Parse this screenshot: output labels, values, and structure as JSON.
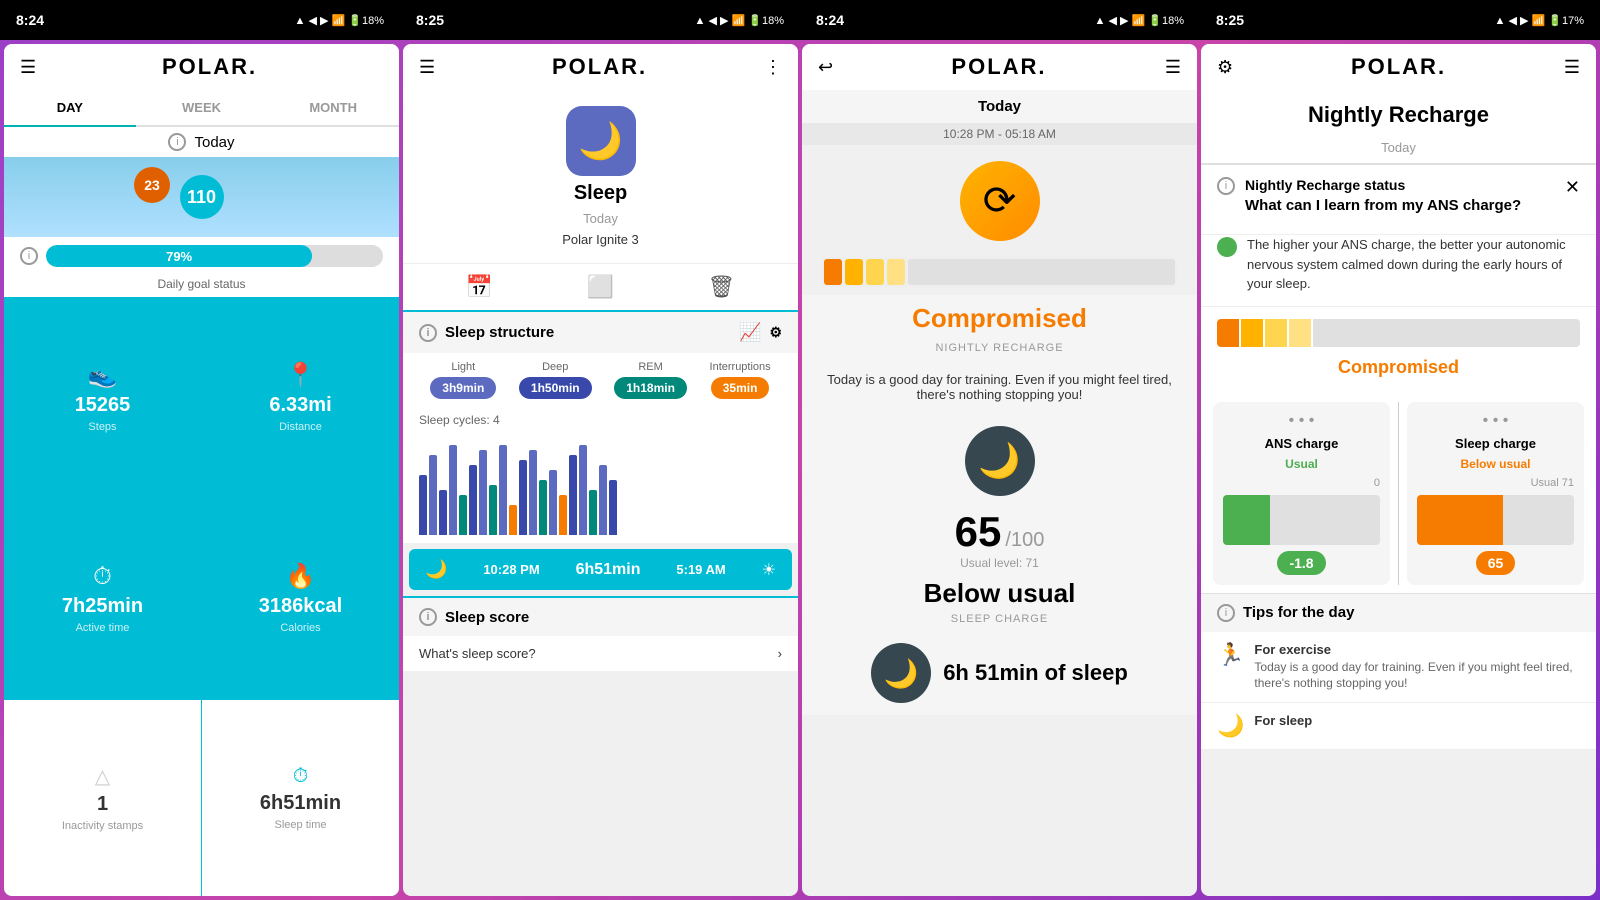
{
  "statusBars": [
    {
      "time": "8:24",
      "icons": "▲ ▼📶🔋18%"
    },
    {
      "time": "8:25",
      "icons": "▲ ▼📶🔋18%"
    },
    {
      "time": "8:24",
      "icons": "▲ ▼📶🔋18%"
    },
    {
      "time": "8:25",
      "icons": "▲ ▼📶🔋17%"
    }
  ],
  "screen1": {
    "tabs": [
      "DAY",
      "WEEK",
      "MONTH"
    ],
    "activeTab": "DAY",
    "todayLabel": "Today",
    "scoreOrange": "23",
    "scoreBadge": "110",
    "progressPct": "79%",
    "progressLabel": "Daily goal status",
    "stats": [
      {
        "icon": "👟",
        "value": "15265",
        "label": "Steps"
      },
      {
        "icon": "📍",
        "value": "6.33mi",
        "label": "Distance"
      },
      {
        "icon": "⏱",
        "value": "7h25min",
        "label": "Active time"
      },
      {
        "icon": "🔥",
        "value": "3186kcal",
        "label": "Calories"
      }
    ],
    "inactivityIcon": "△",
    "inactivityValue": "1",
    "inactivityLabel": "Inactivity stamps",
    "sleepIcon": "⏱",
    "sleepValue": "6h51min",
    "sleepLabel": "Sleep time"
  },
  "screen2": {
    "sleepTitle": "Sleep",
    "sleepDate": "Today",
    "sleepDevice": "Polar Ignite 3",
    "sectionTitle": "Sleep structure",
    "legendItems": [
      {
        "label": "Light",
        "time": "3h9min",
        "color": "badge-light"
      },
      {
        "label": "Deep",
        "time": "1h50min",
        "color": "badge-deep"
      },
      {
        "label": "REM",
        "time": "1h18min",
        "color": "badge-rem"
      },
      {
        "label": "Interruptions",
        "time": "35min",
        "color": "badge-int"
      }
    ],
    "cyclesLabel": "Sleep cycles: 4",
    "startTime": "10:28 PM",
    "duration": "6h51min",
    "endTime": "5:19 AM",
    "scoreTitle": "Sleep score",
    "scoreLink": "What's sleep score?"
  },
  "screen3": {
    "todayLabel": "Today",
    "timeRange": "10:28 PM - 05:18 AM",
    "statusLabel": "Compromised",
    "nrLabel": "NIGHTLY RECHARGE",
    "description": "Today is a good day for training. Even if you might feel tired, there's nothing stopping you!",
    "score": "65",
    "scoreMax": "/100",
    "usualLevel": "Usual level: 71",
    "belowUsual": "Below usual",
    "sleepChargeLabel": "SLEEP CHARGE",
    "sleepDuration": "6h 51min of sleep"
  },
  "screen4": {
    "title": "Nightly Recharge",
    "todayLabel": "Today",
    "infoTitle": "Nightly Recharge status",
    "question": "What can I learn from my ANS charge?",
    "ansText": "The higher your ANS charge, the better your autonomic nervous system calmed down during the early hours of your sleep.",
    "compromisedLabel": "Compromised",
    "ansCharge": {
      "title": "ANS charge",
      "status": "Usual",
      "value": "-1.8"
    },
    "sleepCharge": {
      "title": "Sleep charge",
      "status": "Below usual",
      "value": "65",
      "usual": "Usual 71"
    },
    "tipsHeader": "Tips for the day",
    "tips": [
      {
        "icon": "🏃",
        "title": "For exercise",
        "text": "Today is a good day for training. Even if you might feel tired, there's nothing stopping you!"
      },
      {
        "icon": "🌙",
        "title": "For sleep",
        "text": ""
      }
    ]
  }
}
